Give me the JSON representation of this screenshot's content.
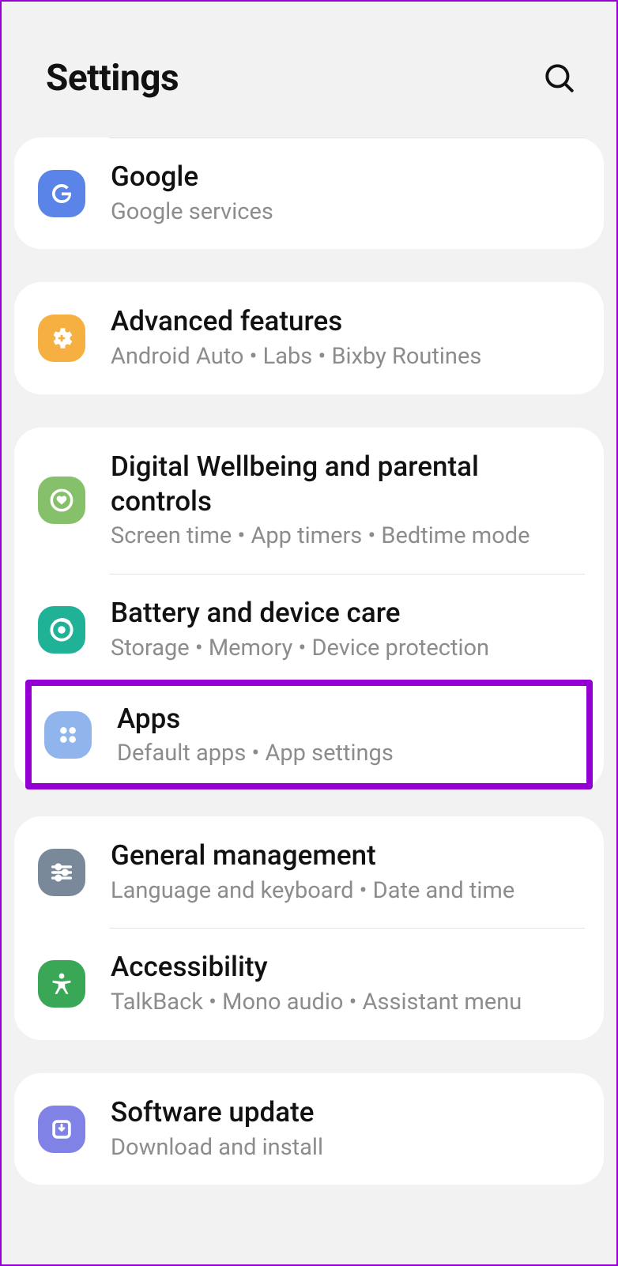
{
  "header": {
    "title": "Settings"
  },
  "groups": [
    {
      "rows": [
        {
          "title": "Google",
          "sub": "Google services"
        }
      ]
    },
    {
      "rows": [
        {
          "title": "Advanced features",
          "sub": "Android Auto  •  Labs  •  Bixby Routines"
        }
      ]
    },
    {
      "rows": [
        {
          "title": "Digital Wellbeing and parental controls",
          "sub": "Screen time  •  App timers  •  Bedtime mode"
        },
        {
          "title": "Battery and device care",
          "sub": "Storage  •  Memory  •  Device protection"
        },
        {
          "title": "Apps",
          "sub": "Default apps  •  App settings"
        }
      ]
    },
    {
      "rows": [
        {
          "title": "General management",
          "sub": "Language and keyboard  •  Date and time"
        },
        {
          "title": "Accessibility",
          "sub": "TalkBack  •  Mono audio  •  Assistant menu"
        }
      ]
    },
    {
      "rows": [
        {
          "title": "Software update",
          "sub": "Download and install"
        }
      ]
    }
  ]
}
